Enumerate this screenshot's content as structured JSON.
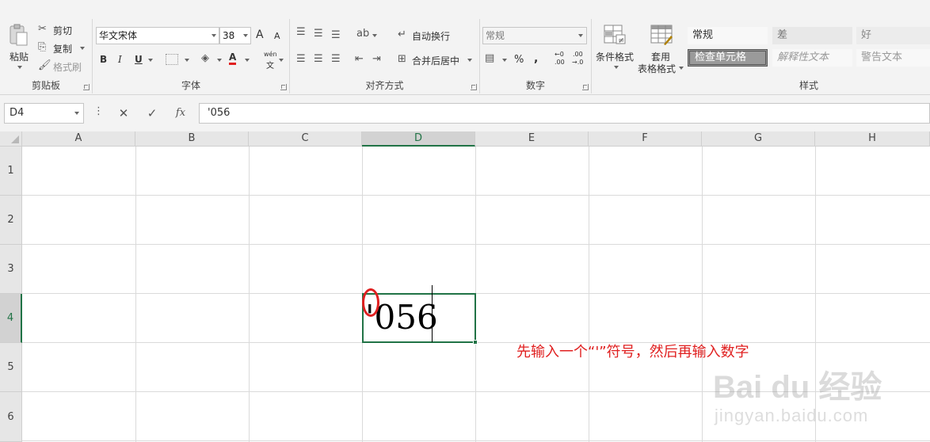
{
  "ribbon": {
    "clipboard": {
      "paste_label": "粘贴",
      "cut_label": "剪切",
      "copy_label": "复制",
      "format_painter_label": "格式刷",
      "group_label": "剪贴板"
    },
    "font": {
      "font_name": "华文宋体",
      "font_size": "38",
      "increase_size": "A",
      "decrease_size": "A",
      "bold": "B",
      "italic": "I",
      "underline": "U",
      "font_color_glyph": "A",
      "phonetic_top": "wén",
      "phonetic_bottom": "文",
      "group_label": "字体"
    },
    "alignment": {
      "wrap_text_label": "自动换行",
      "merge_center_label": "合并后居中",
      "group_label": "对齐方式"
    },
    "number": {
      "format_value": "常规",
      "percent": "%",
      "comma": ",",
      "increase_decimal_top": "←0",
      "increase_decimal_bottom": ".00",
      "decrease_decimal_top": ".00",
      "decrease_decimal_bottom": "→.0",
      "group_label": "数字"
    },
    "styles": {
      "conditional_formatting_label": "条件格式",
      "table_format_label_1": "套用",
      "table_format_label_2": "表格格式",
      "cell_styles": [
        {
          "label": "常规"
        },
        {
          "label": "差"
        },
        {
          "label": "好"
        },
        {
          "label": "检查单元格"
        },
        {
          "label": "解释性文本"
        },
        {
          "label": "警告文本"
        }
      ],
      "group_label": "样式"
    }
  },
  "formula_bar": {
    "name_box": "D4",
    "cancel_glyph": "✕",
    "enter_glyph": "✓",
    "fx_label": "fx",
    "formula_value": "'056"
  },
  "sheet": {
    "columns": [
      "A",
      "B",
      "C",
      "D",
      "E",
      "F",
      "G",
      "H"
    ],
    "rows": [
      "1",
      "2",
      "3",
      "4",
      "5",
      "6"
    ],
    "active_column": "D",
    "active_row": "4",
    "active_cell_text": "'056"
  },
  "annotation": {
    "text": "先输入一个“'”符号，然后再输入数字"
  },
  "watermark": {
    "logo": "Bai du 经验",
    "url": "jingyan.baidu.com"
  },
  "colors": {
    "accent_green": "#217346",
    "annotation_red": "#e02020"
  }
}
